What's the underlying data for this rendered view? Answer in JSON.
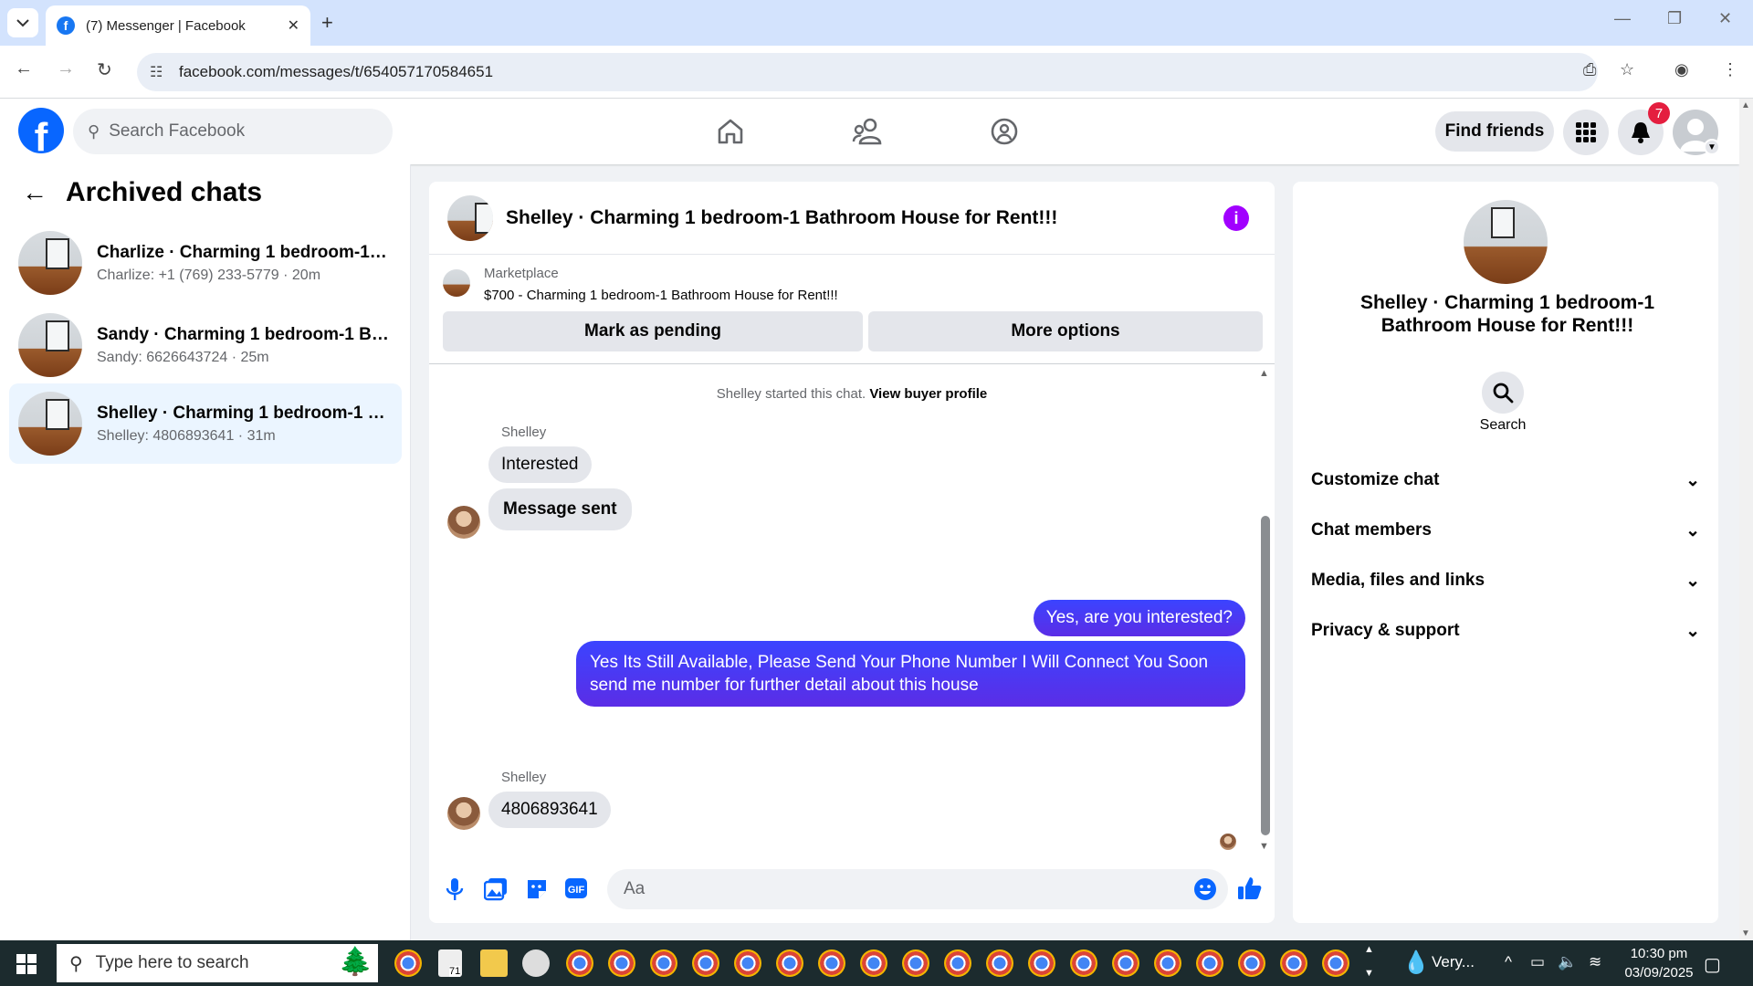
{
  "browser": {
    "tab_title": "(7) Messenger | Facebook",
    "url": "facebook.com/messages/t/654057170584651"
  },
  "fb": {
    "search_placeholder": "Search Facebook",
    "find_friends": "Find friends",
    "notification_count": "7"
  },
  "archived": {
    "title": "Archived chats",
    "chats": [
      {
        "name": "Charlize · Charming 1 bedroom-1 B...",
        "sub": "Charlize: +1 (769) 233-5779 · 20m"
      },
      {
        "name": "Sandy · Charming 1 bedroom-1 Bat...",
        "sub": "Sandy: 6626643724 · 25m"
      },
      {
        "name": "Shelley · Charming 1 bedroom-1 B...",
        "sub": "Shelley: 4806893641 · 31m"
      }
    ]
  },
  "chat": {
    "title": "Shelley · Charming 1 bedroom-1 Bathroom House for Rent!!!",
    "marketplace_label": "Marketplace",
    "listing": "$700 - Charming 1 bedroom-1 Bathroom House for Rent!!!",
    "mark_pending": "Mark as pending",
    "more_options": "More options",
    "started_text": "Shelley started this chat.",
    "view_buyer": "View buyer profile",
    "sender1": "Shelley",
    "msg1": "Interested",
    "msg2": "Message sent",
    "out1": "Yes, are you interested?",
    "out2_line1": "Yes Its Still Available, Please Send Your Phone Number I Will Connect You Soon",
    "out2_line2": "send me number for further detail about this house",
    "sender2": "Shelley",
    "msg3": "4806893641",
    "compose_placeholder": "Aa"
  },
  "right": {
    "name": "Shelley · Charming 1 bedroom-1 Bathroom House for Rent!!!",
    "search_label": "Search",
    "items": [
      "Customize chat",
      "Chat members",
      "Media, files and links",
      "Privacy & support"
    ]
  },
  "taskbar": {
    "search_placeholder": "Type here to search",
    "weather": "Very...",
    "time": "10:30 pm",
    "date": "03/09/2025",
    "badge": "71"
  },
  "colors": {
    "fb_blue": "#0866ff",
    "outgoing_bubble": "#4a3aff",
    "active_chat_bg": "#ebf5ff",
    "info_purple": "#a100ff"
  }
}
